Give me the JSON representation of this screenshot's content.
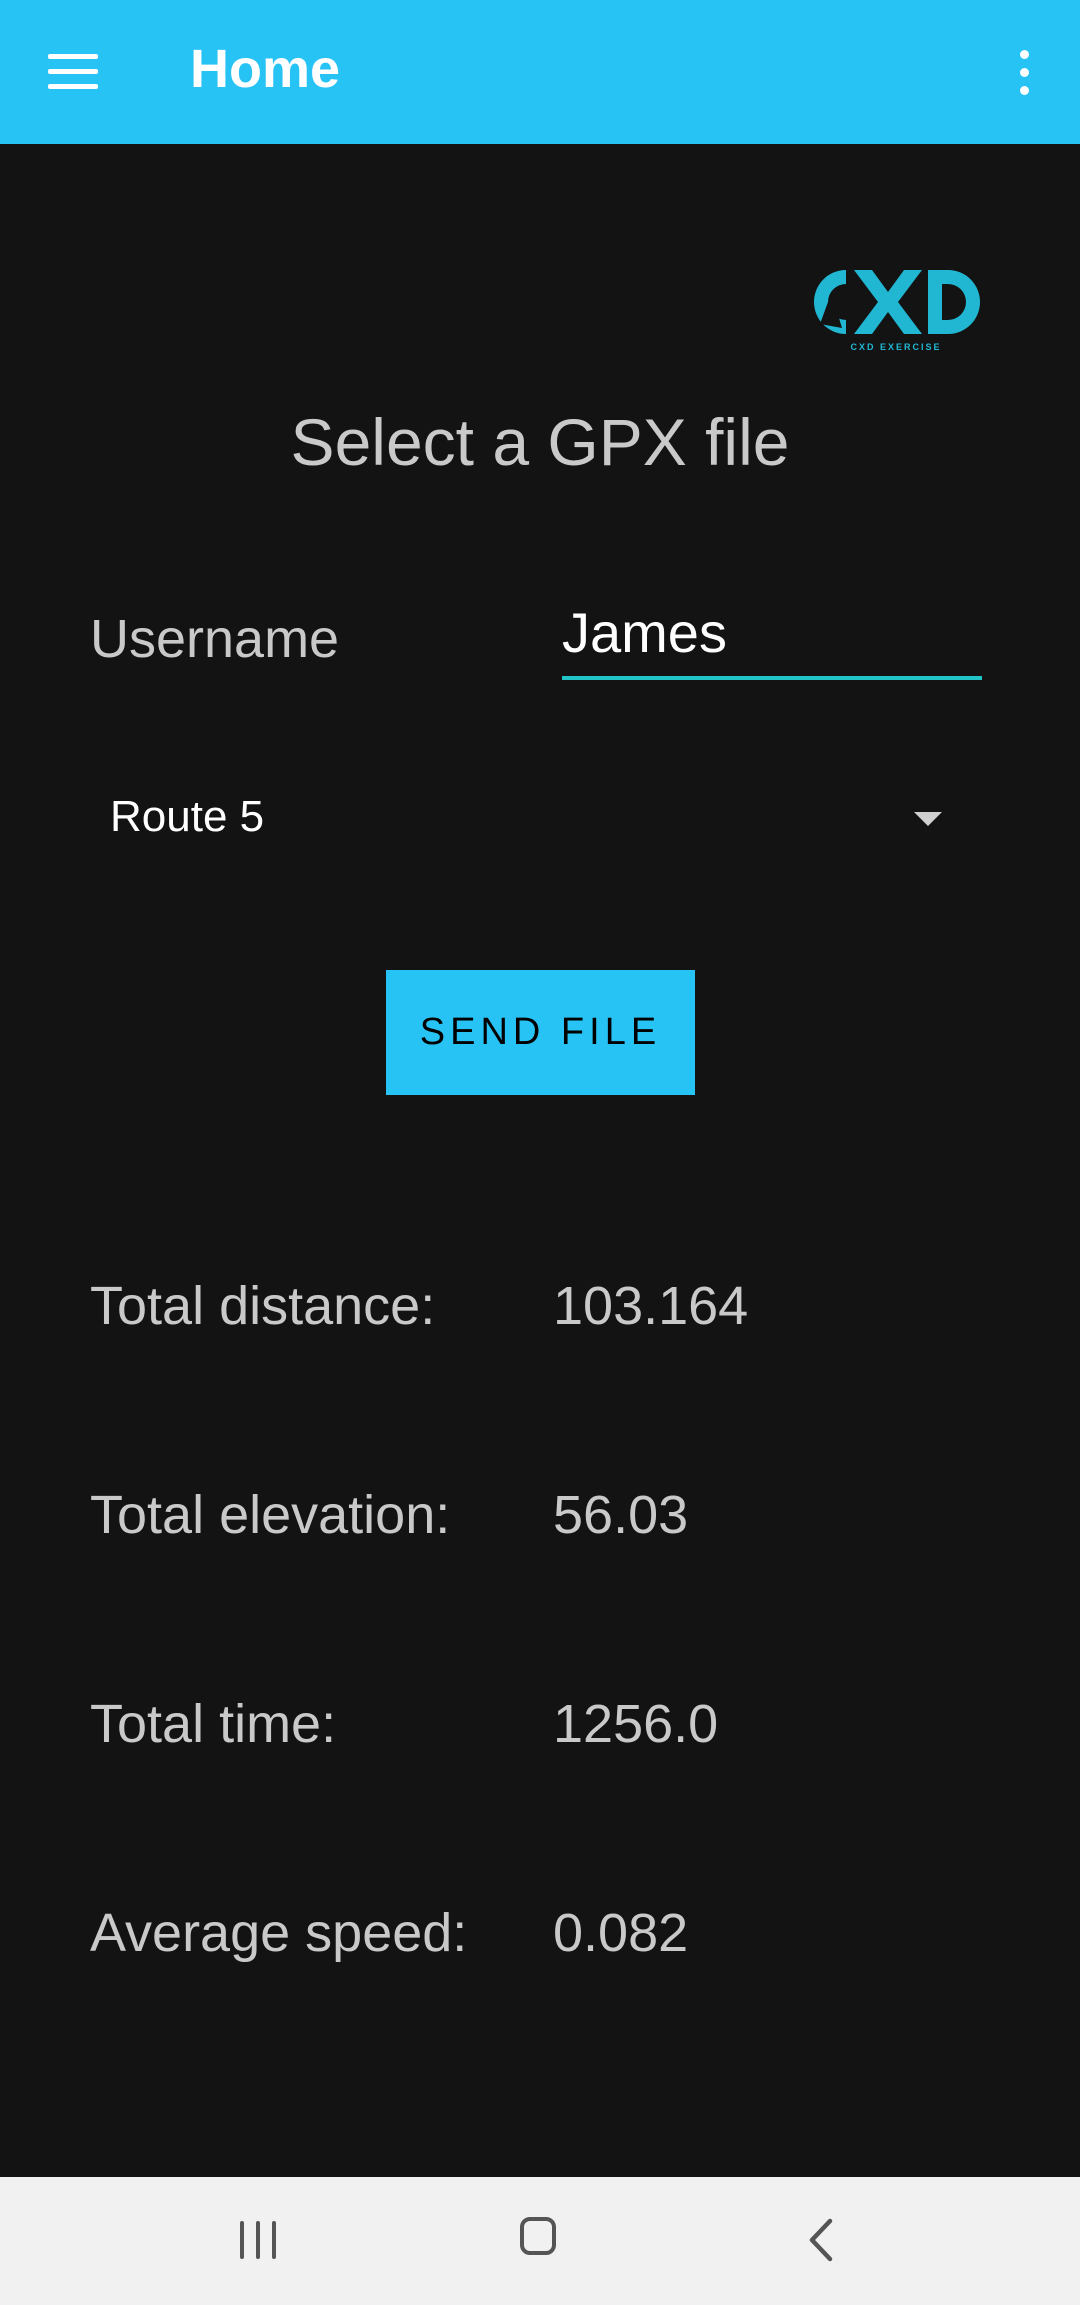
{
  "appbar": {
    "title": "Home",
    "menu_icon": "hamburger-menu-icon",
    "overflow_icon": "more-vert-icon",
    "color": "#28c3f5"
  },
  "logo": {
    "text": "CXD",
    "subtitle": "CXD EXERCISE",
    "color": "#21b7d3"
  },
  "main": {
    "title": "Select a GPX file",
    "username_label": "Username",
    "username_value": "James",
    "route_selected": "Route 5",
    "send_button": "SEND FILE"
  },
  "stats": [
    {
      "label": "Total distance:",
      "value": "103.164"
    },
    {
      "label": "Total elevation:",
      "value": "56.03"
    },
    {
      "label": "Total time:",
      "value": "1256.0"
    },
    {
      "label": "Average speed:",
      "value": "0.082"
    }
  ],
  "navbar": {
    "icons": [
      "recents-icon",
      "home-icon",
      "back-icon"
    ]
  },
  "colors": {
    "background": "#131313",
    "accent": "#28c3f5",
    "field_underline": "#22c4c8"
  }
}
